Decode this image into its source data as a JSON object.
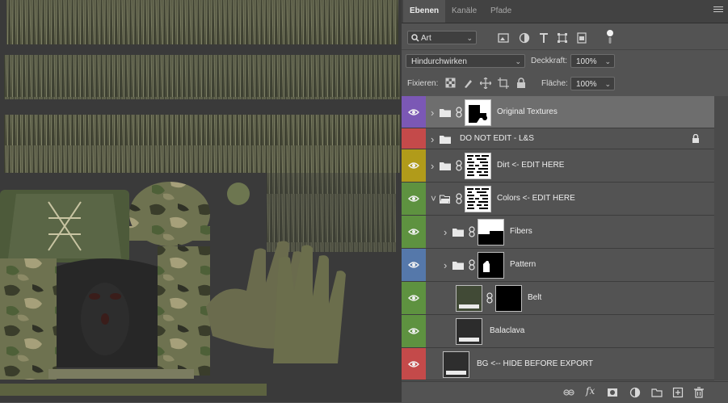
{
  "panel": {
    "tabs": [
      "Ebenen",
      "Kanäle",
      "Pfade"
    ],
    "active_tab": 0
  },
  "filter": {
    "kind_label": "Art"
  },
  "blend": {
    "mode": "Hindurchwirken",
    "opacity_label": "Deckkraft:",
    "opacity_value": "100%",
    "lock_label": "Fixieren:",
    "fill_label": "Fläche:",
    "fill_value": "100%"
  },
  "layers": [
    {
      "name": "Original Textures",
      "color": "#7b58b5",
      "visible": true,
      "type": "group",
      "selected": true,
      "indent": 0,
      "mask": "blob"
    },
    {
      "name": "DO NOT EDIT  - L&S",
      "color": "#c44a4a",
      "visible": false,
      "type": "group",
      "locked": true,
      "indent": 0,
      "mask": "none"
    },
    {
      "name": "Dirt <- EDIT HERE",
      "color": "#b19b1a",
      "visible": true,
      "type": "group",
      "indent": 0,
      "mask": "noise"
    },
    {
      "name": "Colors <- EDIT HERE",
      "color": "#5e9240",
      "visible": true,
      "type": "group",
      "expanded": true,
      "indent": 0,
      "mask": "noise"
    },
    {
      "name": "Fibers",
      "color": "#5e9240",
      "visible": true,
      "type": "group",
      "indent": 1,
      "mask": "fibers"
    },
    {
      "name": "Pattern",
      "color": "#5578aa",
      "visible": true,
      "type": "group",
      "indent": 1,
      "mask": "pattern"
    },
    {
      "name": "Belt",
      "color": "#5e9240",
      "visible": true,
      "type": "fill",
      "indent": 1,
      "swatch": "#414a36",
      "mask": "black"
    },
    {
      "name": "Balaclava",
      "color": "#5e9240",
      "visible": true,
      "type": "fill",
      "indent": 1,
      "swatch": "#2c2c2c"
    },
    {
      "name": "BG <-- HIDE BEFORE EXPORT",
      "color": "#c44a4a",
      "visible": true,
      "type": "fill",
      "indent": 0,
      "swatch": "#2e2e2e"
    }
  ],
  "footer_icons": [
    "link-icon",
    "fx-icon",
    "mask-icon",
    "adjustment-icon",
    "new-group-icon",
    "new-layer-icon",
    "trash-icon"
  ],
  "footer": {
    "fx": "fx"
  }
}
